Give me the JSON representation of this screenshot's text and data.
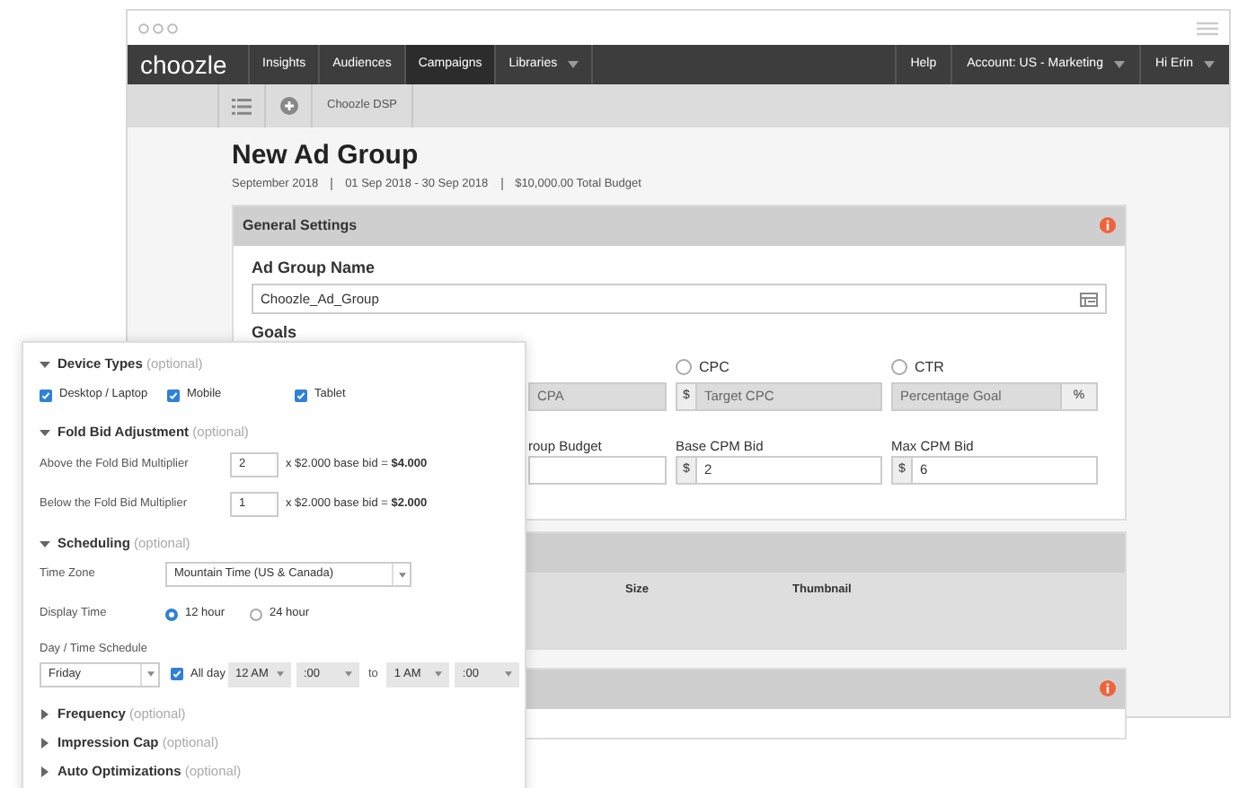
{
  "nav": {
    "brand": "choozle",
    "items": [
      {
        "label": "Insights",
        "selected": false,
        "dropdown": false
      },
      {
        "label": "Audiences",
        "selected": false,
        "dropdown": false
      },
      {
        "label": "Campaigns",
        "selected": true,
        "dropdown": false
      },
      {
        "label": "Libraries",
        "selected": false,
        "dropdown": true
      }
    ],
    "right_items": [
      {
        "label": "Help",
        "dropdown": false
      },
      {
        "label": "Account: US - Marketing",
        "dropdown": true
      },
      {
        "label": "Hi Erin",
        "dropdown": true
      }
    ]
  },
  "subbar": {
    "crumb": "Choozle DSP"
  },
  "page": {
    "title": "New Ad Group",
    "meta": [
      "September 2018",
      "01 Sep 2018 - 30 Sep 2018",
      "$10,000.00 Total Budget"
    ]
  },
  "general_settings": {
    "title": "General Settings",
    "name_label": "Ad Group Name",
    "name_value": "Choozle_Ad_Group",
    "goals_label": "Goals",
    "goals": [
      {
        "placeholder": "CPA"
      },
      {
        "label": "CPC",
        "selected": false,
        "prefix": "$",
        "placeholder": "Target CPC"
      },
      {
        "label": "CTR",
        "selected": false,
        "placeholder": "Percentage Goal",
        "suffix": "%"
      }
    ],
    "bids": [
      {
        "label": "roup Budget"
      },
      {
        "label": "Base CPM Bid",
        "prefix": "$",
        "value": "2"
      },
      {
        "label": "Max CPM Bid",
        "prefix": "$",
        "value": "6"
      }
    ]
  },
  "creatives": {
    "columns": [
      "Size",
      "Thumbnail"
    ]
  },
  "panel": {
    "sections": [
      {
        "kind": "checkboxes",
        "title": "Device Types",
        "hint": "(optional)",
        "expanded": true,
        "options": [
          {
            "label": "Desktop / Laptop",
            "checked": true
          },
          {
            "label": "Mobile",
            "checked": true
          },
          {
            "label": "Tablet",
            "checked": true
          }
        ]
      },
      {
        "kind": "multipliers",
        "title": "Fold Bid Adjustment",
        "hint": "(optional)",
        "expanded": true,
        "rows": [
          {
            "label": "Above the Fold Bid Multiplier",
            "value": "2",
            "formula": "x $2.000 base bid = **$4.000**"
          },
          {
            "label": "Below the Fold Bid Multiplier",
            "value": "1",
            "formula": "x $2.000 base bid = **$2.000**"
          }
        ]
      },
      {
        "kind": "scheduling",
        "title": "Scheduling",
        "hint": "(optional)",
        "expanded": true,
        "time_zone": {
          "label": "Time Zone",
          "value": "Mountain Time (US & Canada)"
        },
        "display_time": {
          "label": "Display Time",
          "options": [
            {
              "label": "12 hour",
              "selected": true
            },
            {
              "label": "24 hour",
              "selected": false
            }
          ]
        },
        "schedule": {
          "label": "Day / Time Schedule",
          "day": "Friday",
          "all_day": {
            "label": "All day",
            "checked": true
          },
          "from_hour": "12 AM",
          "from_minute": ":00",
          "to": "to",
          "to_hour": "1 AM",
          "to_minute": ":00"
        }
      },
      {
        "kind": "collapsed",
        "title": "Frequency",
        "hint": "(optional)",
        "expanded": false
      },
      {
        "kind": "collapsed",
        "title": "Impression Cap",
        "hint": "(optional)",
        "expanded": false
      },
      {
        "kind": "collapsed",
        "title": "Auto Optimizations",
        "hint": "(optional)",
        "expanded": false
      }
    ]
  }
}
